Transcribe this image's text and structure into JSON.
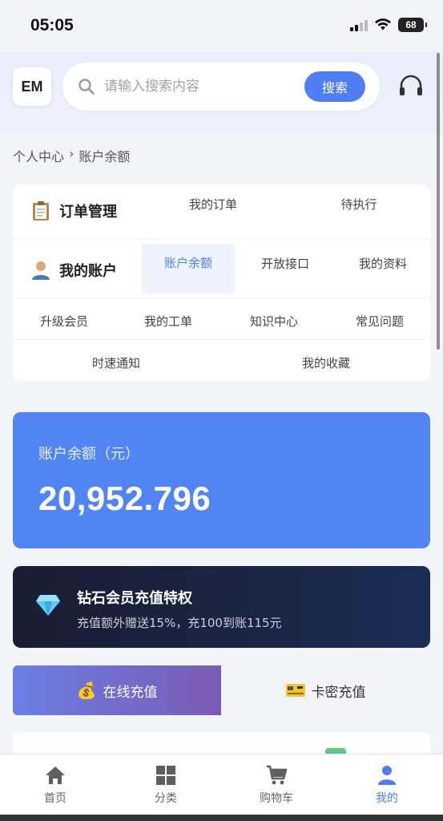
{
  "status_bar": {
    "time": "05:05",
    "battery": "68"
  },
  "header": {
    "logo": "EM",
    "search": {
      "placeholder": "请输入搜索内容",
      "button": "搜索"
    },
    "support_icon": "headset-icon"
  },
  "breadcrumb": {
    "home": "个人中心",
    "separator": "›",
    "current": "账户余额"
  },
  "menu": {
    "order_group": {
      "title": "订单管理",
      "icon": "clipboard-icon",
      "items": [
        "我的订单",
        "待执行"
      ]
    },
    "account_group": {
      "title": "我的账户",
      "icon": "user-icon",
      "items": [
        "账户余额",
        "开放接口",
        "我的资料"
      ],
      "active": "账户余额"
    },
    "row3": [
      "升级会员",
      "我的工单",
      "知识中心",
      "常见问题"
    ],
    "row4": [
      "时速通知",
      "我的收藏"
    ]
  },
  "balance": {
    "label": "账户余额（元）",
    "value": "20,952.796"
  },
  "vip": {
    "title": "钻石会员充值特权",
    "desc": "充值额外赠送15%，充100到账115元",
    "icon": "diamond-icon"
  },
  "recharge_tabs": {
    "online": "在线充值",
    "card": "卡密充值",
    "online_icon": "money-bag-icon",
    "card_icon": "card-icon"
  },
  "tabbar": {
    "items": [
      {
        "label": "首页",
        "icon": "home-icon"
      },
      {
        "label": "分类",
        "icon": "grid-icon"
      },
      {
        "label": "购物车",
        "icon": "cart-icon"
      },
      {
        "label": "我的",
        "icon": "profile-icon"
      }
    ],
    "active": "我的"
  },
  "colors": {
    "accent": "#4f7df3",
    "balance_card": "#5285f4",
    "vip_card": "#1b2544"
  }
}
